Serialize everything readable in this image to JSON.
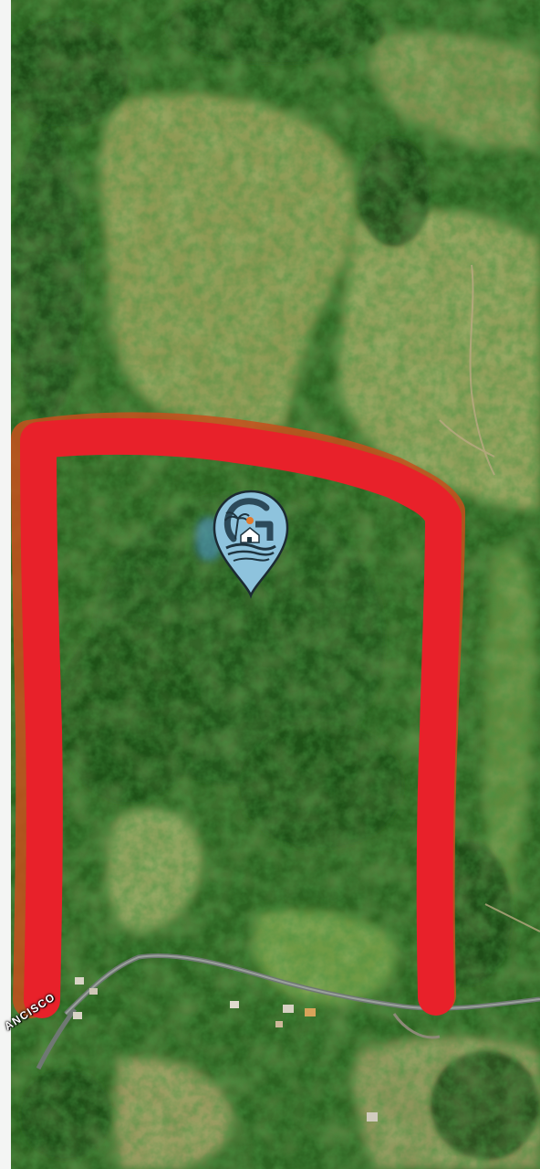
{
  "map": {
    "road_label": "ANCISCO",
    "boundary": {
      "color": "#e8212a",
      "description_word": "parcel-outline"
    },
    "pin": {
      "icon": "location-pin-logo-icon",
      "fill_color": "#8ec3dd",
      "outline_color": "#1b2a33",
      "logo_letter": "G",
      "accent_color": "#e27b2e"
    },
    "colors": {
      "forest_dark": "#1f4e1b",
      "forest_mid": "#2f6b22",
      "pasture": "#8a9b5a",
      "road": "#7d8580"
    }
  }
}
